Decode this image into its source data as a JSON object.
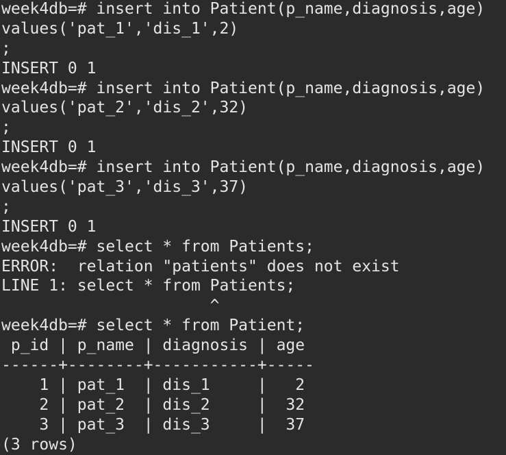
{
  "terminal": {
    "lines": [
      "week4db=# insert into Patient(p_name,diagnosis,age)",
      "values('pat_1','dis_1',2)",
      ";",
      "INSERT 0 1",
      "week4db=# insert into Patient(p_name,diagnosis,age)",
      "values('pat_2','dis_2',32)",
      ";",
      "INSERT 0 1",
      "week4db=# insert into Patient(p_name,diagnosis,age)",
      "values('pat_3','dis_3',37)",
      ";",
      "INSERT 0 1",
      "week4db=# select * from Patients;",
      "ERROR:  relation \"patients\" does not exist",
      "LINE 1: select * from Patients;",
      "                      ^",
      "week4db=# select * from Patient;",
      " p_id | p_name | diagnosis | age",
      "------+--------+-----------+-----",
      "    1 | pat_1  | dis_1     |   2",
      "    2 | pat_2  | dis_2     |  32",
      "    3 | pat_3  | dis_3     |  37",
      "(3 rows)"
    ]
  }
}
